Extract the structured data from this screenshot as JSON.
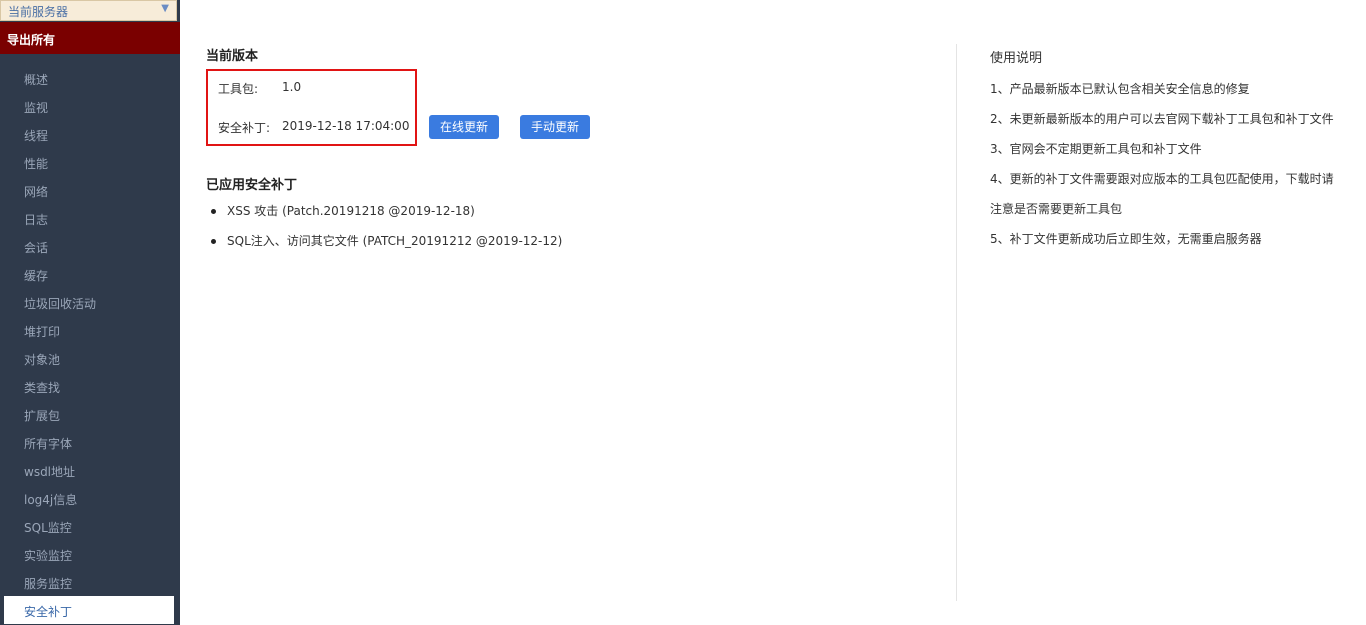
{
  "sidebar": {
    "server_select": "当前服务器",
    "export_all": "导出所有",
    "items": [
      {
        "label": "概述"
      },
      {
        "label": "监视"
      },
      {
        "label": "线程"
      },
      {
        "label": "性能"
      },
      {
        "label": "网络"
      },
      {
        "label": "日志"
      },
      {
        "label": "会话"
      },
      {
        "label": "缓存"
      },
      {
        "label": "垃圾回收活动"
      },
      {
        "label": "堆打印"
      },
      {
        "label": "对象池"
      },
      {
        "label": "类查找"
      },
      {
        "label": "扩展包"
      },
      {
        "label": "所有字体"
      },
      {
        "label": "wsdl地址"
      },
      {
        "label": "log4j信息"
      },
      {
        "label": "SQL监控"
      },
      {
        "label": "实验监控"
      },
      {
        "label": "服务监控"
      },
      {
        "label": "安全补丁"
      }
    ],
    "active_index": 19
  },
  "main": {
    "current_version_title": "当前版本",
    "toolkit_label": "工具包:",
    "toolkit_value": "1.0",
    "patch_label": "安全补丁:",
    "patch_value": "2019-12-18 17:04:00",
    "online_update_button": "在线更新",
    "manual_update_button": "手动更新",
    "applied_patches_title": "已应用安全补丁",
    "applied_patches": [
      "XSS 攻击 (Patch.20191218 @2019-12-18)",
      "SQL注入、访问其它文件 (PATCH_20191212 @2019-12-12)"
    ]
  },
  "help": {
    "title": "使用说明",
    "items": [
      "1、产品最新版本已默认包含相关安全信息的修复",
      "2、未更新最新版本的用户可以去官网下载补丁工具包和补丁文件",
      "3、官网会不定期更新工具包和补丁文件",
      "4、更新的补丁文件需要跟对应版本的工具包匹配使用，下载时请",
      "注意是否需要更新工具包",
      "5、补丁文件更新成功后立即生效，无需重启服务器"
    ]
  },
  "colors": {
    "sidebar_bg": "#2f3a4b",
    "export_bg": "#7a0000",
    "button_bg": "#3a7be0",
    "highlight_border": "#e11414"
  },
  "icons": {
    "server_dropdown": "chevron-down-icon"
  }
}
